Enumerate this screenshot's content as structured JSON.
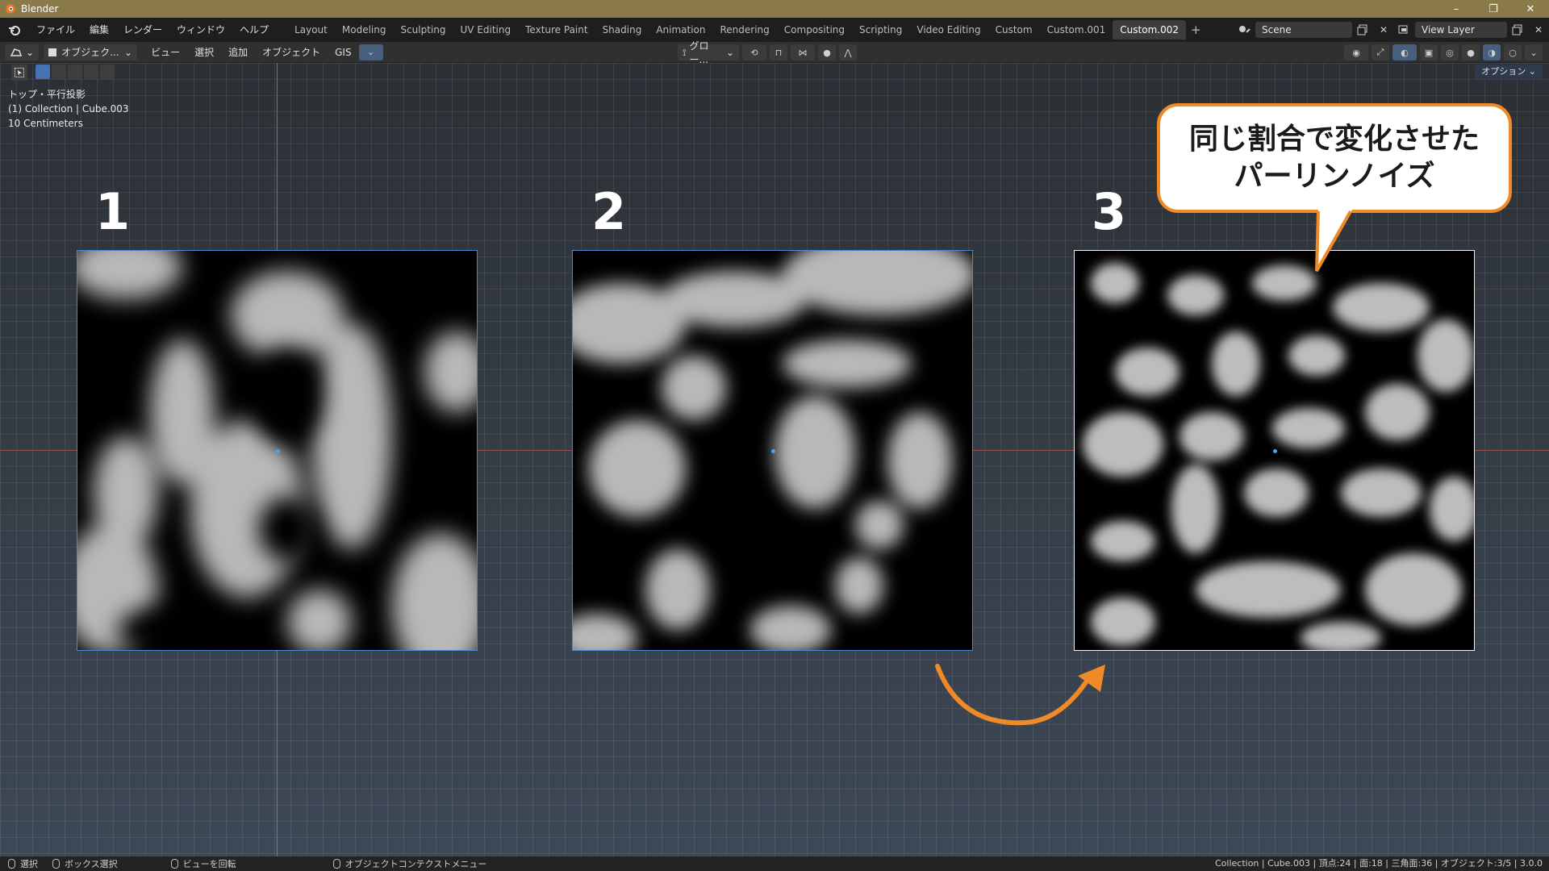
{
  "window": {
    "title": "Blender",
    "controls": [
      "–",
      "❐",
      "✕"
    ]
  },
  "menu": {
    "items": [
      "ファイル",
      "編集",
      "レンダー",
      "ウィンドウ",
      "ヘルプ"
    ]
  },
  "workspaces": [
    "Layout",
    "Modeling",
    "Sculpting",
    "UV Editing",
    "Texture Paint",
    "Shading",
    "Animation",
    "Rendering",
    "Compositing",
    "Scripting",
    "Video Editing",
    "Custom",
    "Custom.001",
    "Custom.002"
  ],
  "active_workspace": "Custom.002",
  "scene": {
    "name": "Scene",
    "view_layer": "View Layer"
  },
  "viewport_header": {
    "mode": "オブジェク...",
    "menus": [
      "ビュー",
      "選択",
      "追加",
      "オブジェクト",
      "GIS"
    ],
    "transform_orientation": "グロー...",
    "options": "オプション"
  },
  "view_info": {
    "view_name": "トップ・平行投影",
    "collection": "(1) Collection | Cube.003",
    "scale": "10 Centimeters"
  },
  "panels": [
    {
      "number": "1"
    },
    {
      "number": "2"
    },
    {
      "number": "3"
    }
  ],
  "callout": {
    "line1": "同じ割合で変化させた",
    "line2": "パーリンノイズ"
  },
  "colors": {
    "accent_orange": "#f08a26",
    "selection_blue": "#4a88d6",
    "title_bar": "#8a7a4a"
  },
  "statusbar": {
    "select": "選択",
    "box_select": "ボックス選択",
    "rotate_view": "ビューを回転",
    "context_menu": "オブジェクトコンテクストメニュー",
    "stats": "Collection | Cube.003 | 頂点:24 | 面:18 | 三角面:36 | オブジェクト:3/5 | 3.0.0"
  }
}
